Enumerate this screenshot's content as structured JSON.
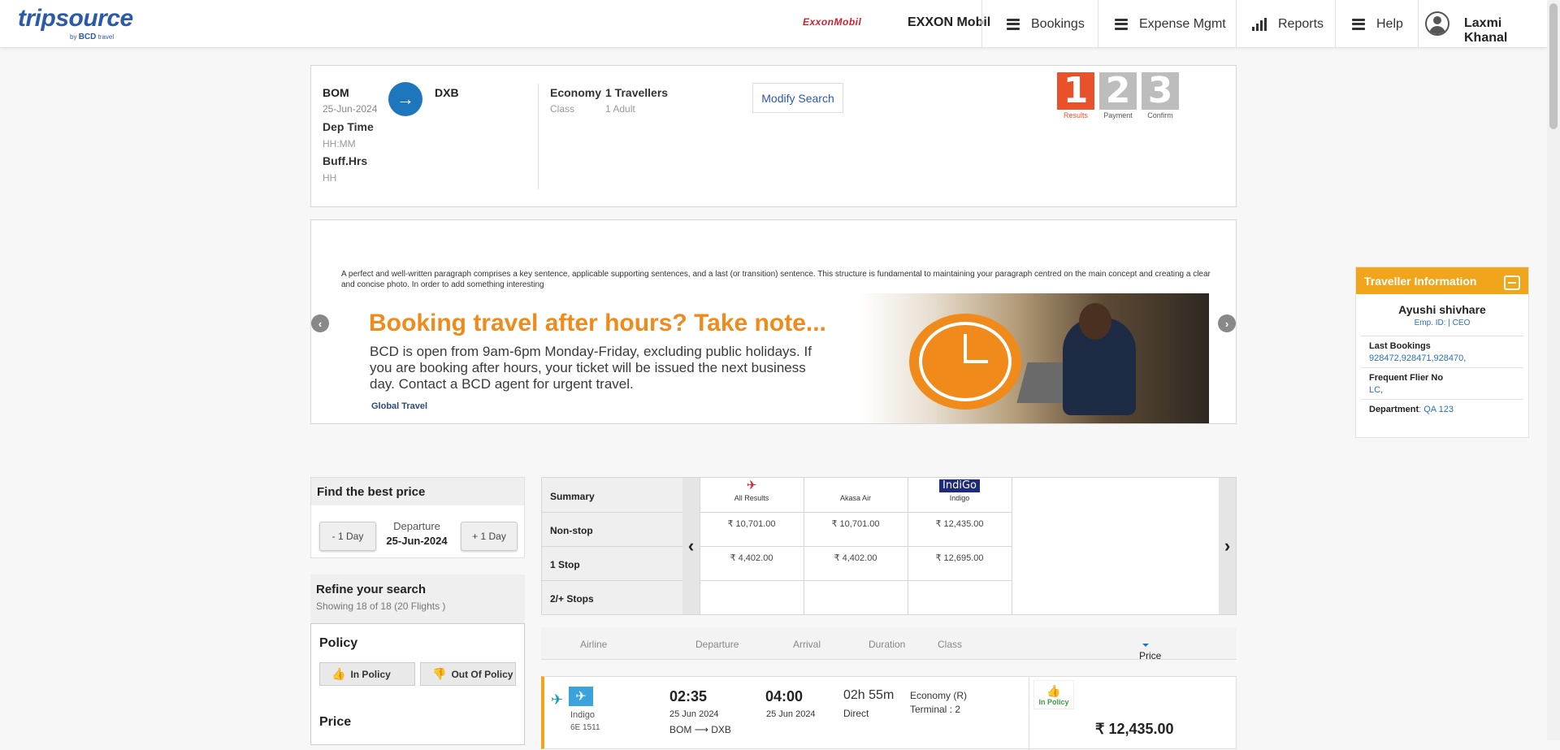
{
  "nav": {
    "logo": {
      "brand": "tripsource",
      "by": "by",
      "bcd": "BCD",
      "travel": "travel"
    },
    "company_logo": "ExxonMobil",
    "company_name": "EXXON Mobil",
    "items": [
      {
        "label": "Bookings",
        "icon": "menu-icon"
      },
      {
        "label": "Expense Mgmt",
        "icon": "menu-icon"
      },
      {
        "label": "Reports",
        "icon": "bar-chart-icon"
      },
      {
        "label": "Help",
        "icon": "menu-icon"
      }
    ],
    "user_name": "Laxmi Khanal"
  },
  "search": {
    "from": "BOM",
    "date": "25-Jun-2024",
    "to": "DXB",
    "dep_time_label": "Dep Time",
    "dep_time_value": "HH:MM",
    "buff_label": "Buff.Hrs",
    "buff_value": "HH",
    "class_label": "Economy",
    "class_sub": "Class",
    "travellers_label": "1 Travellers",
    "travellers_sub": "1 Adult",
    "modify_label": "Modify Search",
    "steps": [
      {
        "num": "1",
        "label": "Results",
        "active": true
      },
      {
        "num": "2",
        "label": "Payment",
        "active": false
      },
      {
        "num": "3",
        "label": "Confirm",
        "active": false
      }
    ]
  },
  "banner": {
    "paragraph": "A perfect and well-written paragraph comprises a key sentence, applicable supporting sentences, and a last (or transition) sentence. This structure is fundamental to maintaining your paragraph centred on the main concept and creating a clear and concise photo. In order to add something interesting",
    "title": "Booking travel after hours? Take note...",
    "body": "BCD is open from 9am-6pm Monday-Friday, excluding public holidays. If you are booking after hours, your ticket will be issued the next business day. Contact a BCD agent for urgent travel.",
    "footer": "Global Travel"
  },
  "traveller": {
    "header": "Traveller Information",
    "name": "Ayushi shivhare",
    "emp": "Emp. ID: | CEO",
    "last_bookings_label": "Last Bookings",
    "last_bookings_value": "928472,928471,928470,",
    "ffn_label": "Frequent Flier No",
    "ffn_value": "LC,",
    "dept_label": "Department",
    "dept_value": "QA 123"
  },
  "best_price": {
    "title": "Find the best price",
    "minus": "- 1 Day",
    "plus": "+ 1 Day",
    "dep_label": "Departure",
    "dep_date": "25-Jun-2024"
  },
  "refine": {
    "title": "Refine your search",
    "subtitle": "Showing 18 of 18 (20 Flights )",
    "policy_title": "Policy",
    "in_policy": "In Policy",
    "out_policy": "Out Of Policy",
    "price_title": "Price"
  },
  "matrix": {
    "rows": [
      "Summary",
      "Non-stop",
      "1 Stop",
      "2/+ Stops"
    ],
    "columns": [
      {
        "airline": "All Results",
        "logo": "plane-icon",
        "nonstop": "₹ 10,701.00",
        "onestop": "₹ 4,402.00",
        "twoplus": ""
      },
      {
        "airline": "Akasa Air",
        "logo": "",
        "nonstop": "₹ 10,701.00",
        "onestop": "₹ 4,402.00",
        "twoplus": ""
      },
      {
        "airline": "Indigo",
        "logo": "IndiGo",
        "nonstop": "₹ 12,435.00",
        "onestop": "₹ 12,695.00",
        "twoplus": ""
      }
    ]
  },
  "results_header": {
    "airline": "Airline",
    "departure": "Departure",
    "arrival": "Arrival",
    "duration": "Duration",
    "class": "Class",
    "price": "Price"
  },
  "flight": {
    "airline": "Indigo",
    "code": "6E  1511",
    "dep_time": "02:35",
    "dep_date": "25 Jun 2024",
    "arr_time": "04:00",
    "arr_date": "25 Jun 2024",
    "duration": "02h 55m",
    "stops": "Direct",
    "class": "Economy (R)",
    "terminal": "Terminal : 2",
    "from": "BOM",
    "to": "DXB",
    "policy": "In Policy",
    "price": "₹ 12,435.00"
  },
  "colors": {
    "accent": "#f0a51b",
    "brand_blue": "#2b5aa8",
    "step_active": "#e9512b",
    "policy_green": "#3a9b3a"
  }
}
